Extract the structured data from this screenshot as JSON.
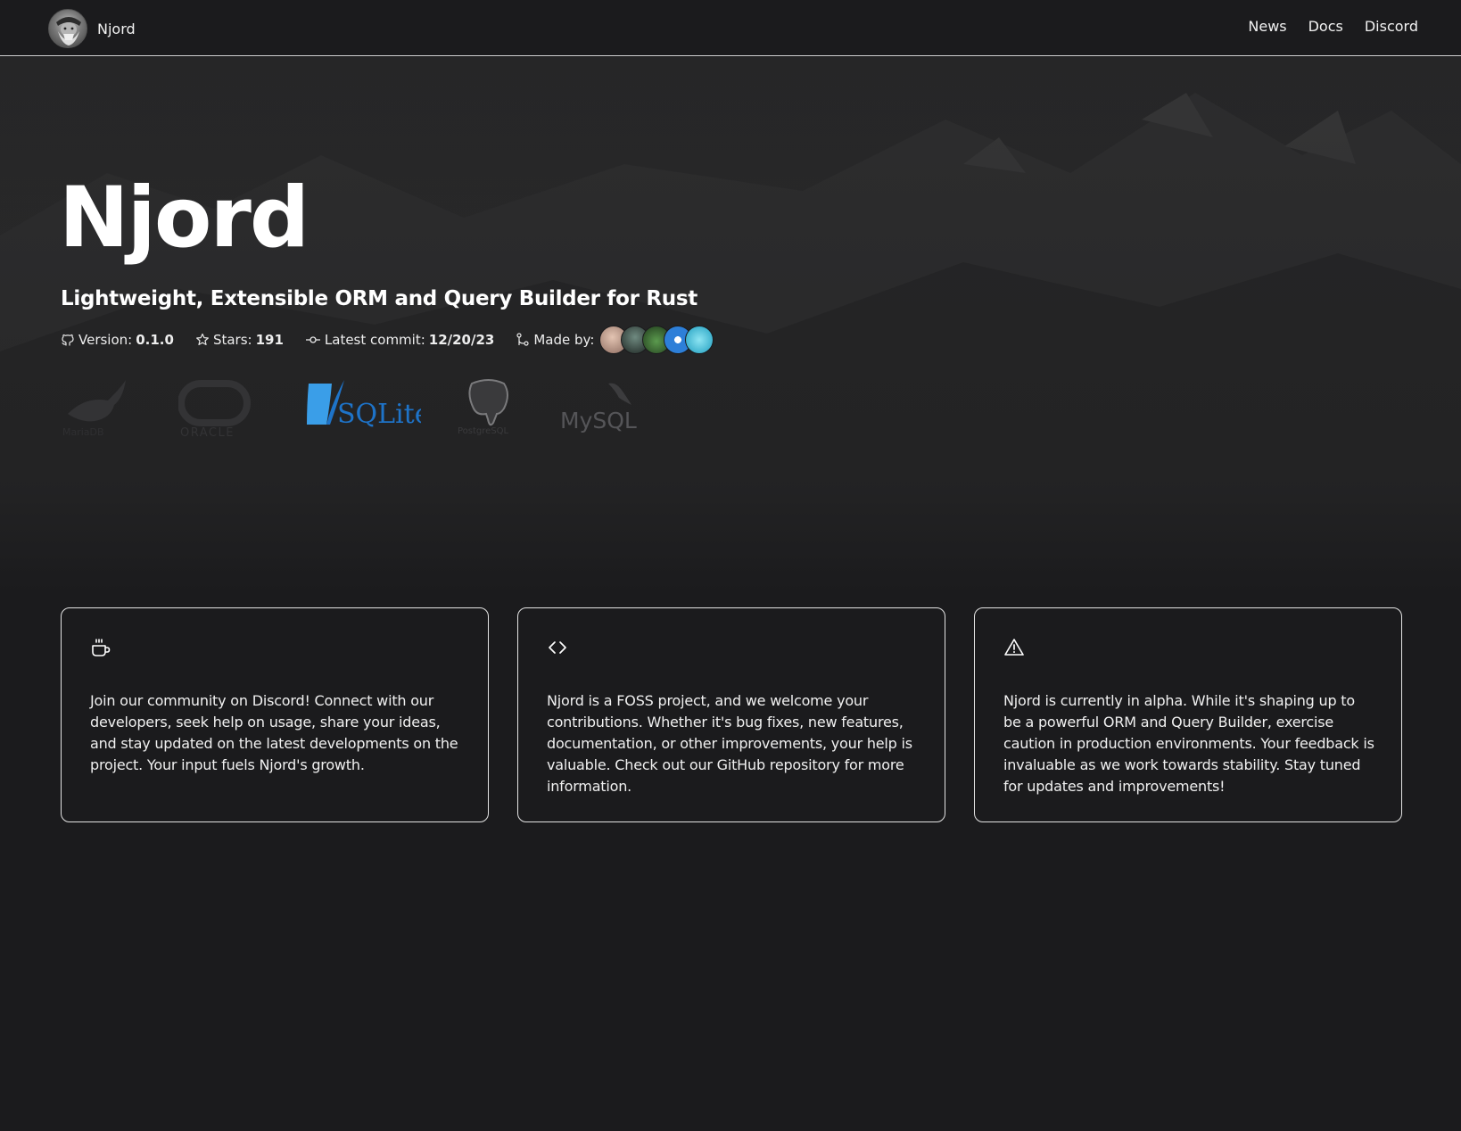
{
  "header": {
    "logo_icon": "njord-logo-icon",
    "brand": "Njord",
    "nav": [
      {
        "label": "News"
      },
      {
        "label": "Docs"
      },
      {
        "label": "Discord"
      }
    ]
  },
  "hero": {
    "title": "Njord",
    "subtitle": "Lightweight, Extensible ORM and Query Builder for Rust",
    "meta": {
      "version_label": "Version:",
      "version_value": "0.1.0",
      "stars_label": "Stars:",
      "stars_value": "191",
      "commit_label": "Latest commit:",
      "commit_value": "12/20/23",
      "made_by_label": "Made by:"
    },
    "contributors": [
      {
        "color": "#b98a78"
      },
      {
        "color": "#3e4a44"
      },
      {
        "color": "#3f6b3a"
      },
      {
        "color": "#2d7fd8"
      },
      {
        "color": "#2aa8c9"
      }
    ],
    "databases": [
      {
        "name": "MariaDB",
        "label": "MariaDB"
      },
      {
        "name": "Oracle",
        "label": "ORACLE"
      },
      {
        "name": "SQLite",
        "label": "SQLite"
      },
      {
        "name": "PostgreSQL",
        "label": "PostgreSQL"
      },
      {
        "name": "MySQL",
        "label": "MySQL"
      }
    ]
  },
  "cards": [
    {
      "icon": "coffee-cup-icon",
      "text": "Join our community on Discord! Connect with our developers, seek help on usage, share your ideas, and stay updated on the latest developments on the project. Your input fuels Njord's growth."
    },
    {
      "icon": "code-brackets-icon",
      "text": "Njord is a FOSS project, and we welcome your contributions. Whether it's bug fixes, new features, documentation, or other improvements, your help is valuable. Check out our GitHub repository for more information."
    },
    {
      "icon": "warning-triangle-icon",
      "text": "Njord is currently in alpha. While it's shaping up to be a powerful ORM and Query Builder, exercise caution in production environments. Your feedback is invaluable as we work towards stability. Stay tuned for updates and improvements!"
    }
  ],
  "colors": {
    "background": "#1b1b1d",
    "text": "#ffffff",
    "card_border": "#e4e4e4",
    "sqlite_blue": "#1e73c8"
  }
}
